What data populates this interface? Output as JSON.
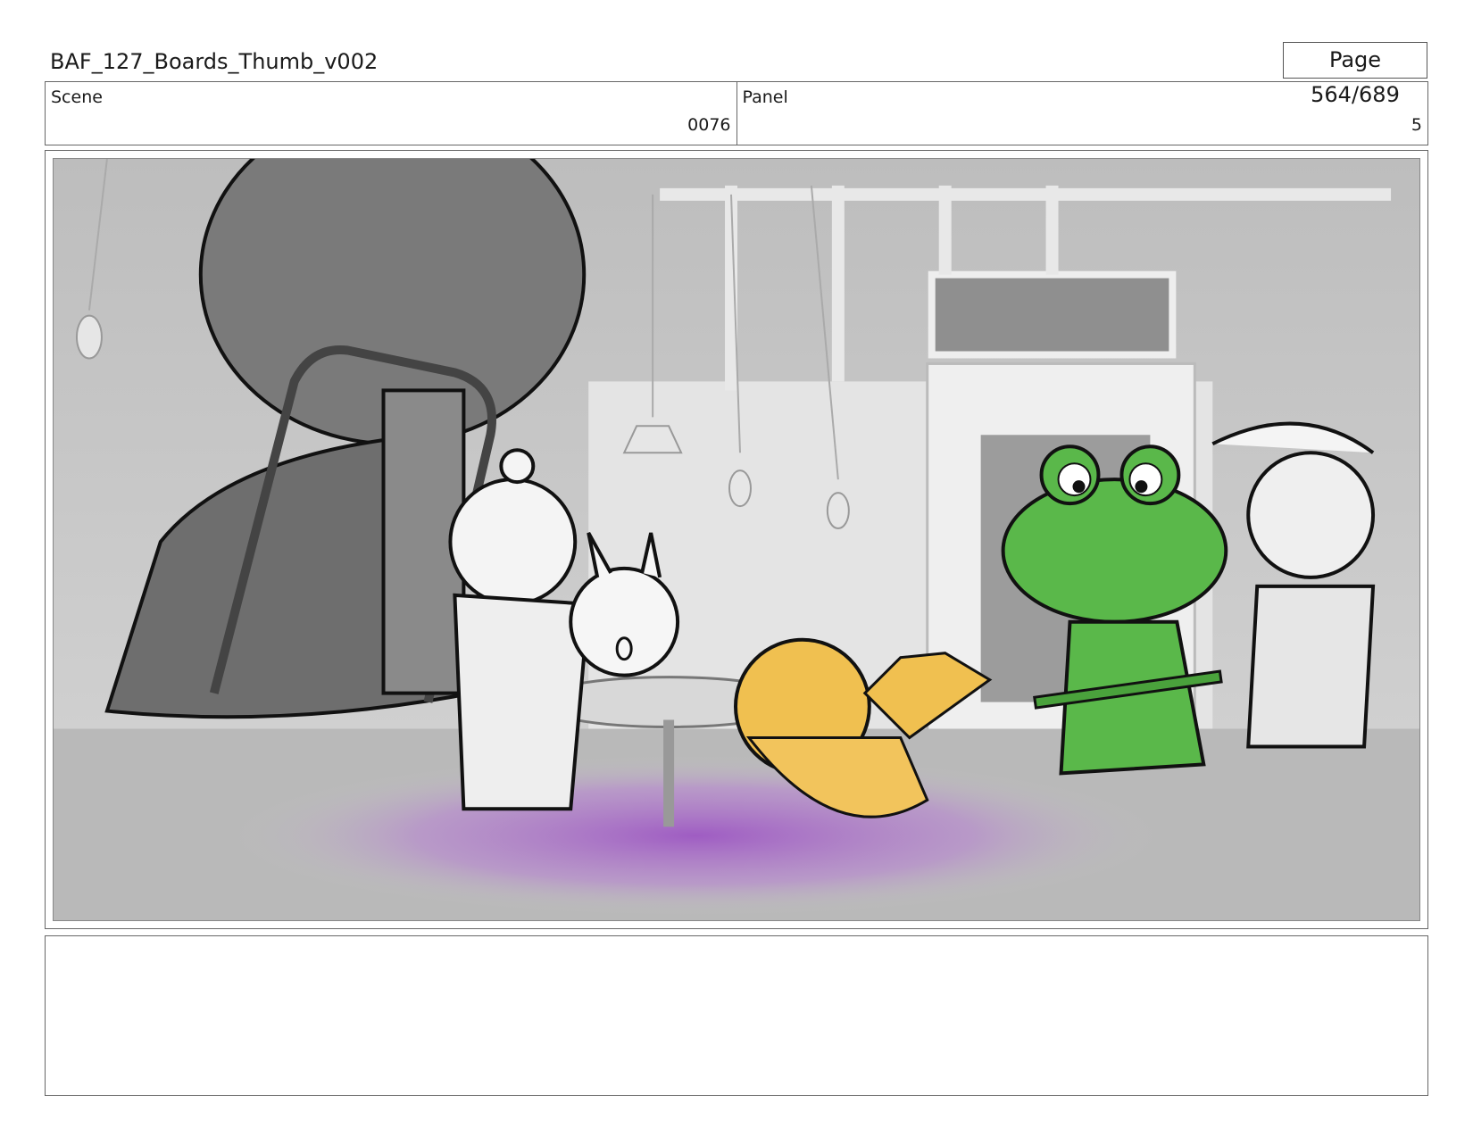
{
  "document": {
    "title": "BAF_127_Boards_Thumb_v002",
    "page": "Page 564/689"
  },
  "header": {
    "scene_label": "Scene",
    "scene_value": "0076",
    "panel_label": "Panel",
    "panel_value": "5"
  },
  "panel_image": {
    "colors": {
      "background": "#c9c9c9",
      "frog": "#5ab84a",
      "chick": "#f0c050",
      "smoke": "#a060c8",
      "ink": "#111111"
    }
  },
  "notes": {
    "text": ""
  }
}
